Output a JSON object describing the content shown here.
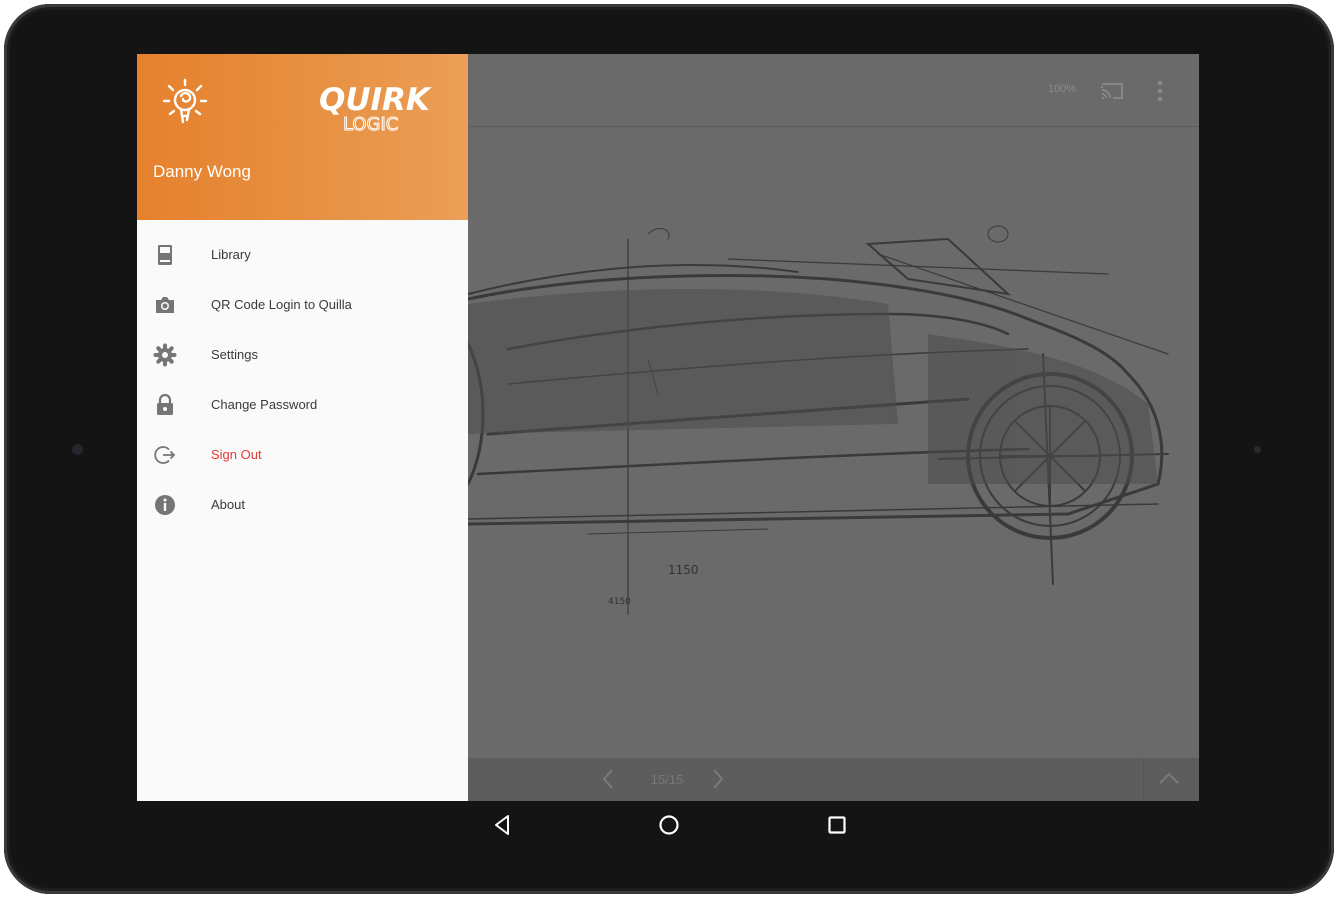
{
  "colors": {
    "accent": "#e6812d",
    "danger": "#e53935",
    "scrim": "#6a6a6a",
    "drawer_bg": "#fafafa"
  },
  "drawer": {
    "user_name": "Danny Wong",
    "logo": {
      "icon": "lightbulb-icon",
      "line1": "QUIRK",
      "line2": "LOGIC"
    },
    "items": [
      {
        "label": "Library",
        "icon": "book-icon"
      },
      {
        "label": "QR Code Login to Quilla",
        "icon": "camera-icon"
      },
      {
        "label": "Settings",
        "icon": "gear-icon"
      },
      {
        "label": "Change Password",
        "icon": "lock-icon"
      },
      {
        "label": "Sign Out",
        "icon": "sign-out-icon"
      },
      {
        "label": "About",
        "icon": "info-icon"
      }
    ]
  },
  "viewer": {
    "zoom": "100%",
    "page_indicator": "15/15",
    "actions": [
      "cast-icon",
      "more-vert-icon"
    ],
    "sketch_annotations": [
      "1150",
      "4150"
    ]
  },
  "nav_bar": [
    "back-icon",
    "home-icon",
    "recents-icon"
  ]
}
